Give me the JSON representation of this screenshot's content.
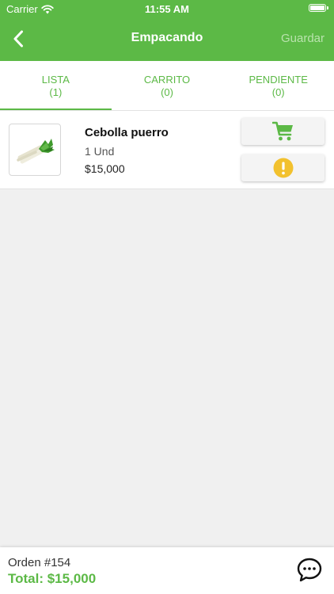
{
  "status_bar": {
    "carrier": "Carrier",
    "time": "11:55 AM",
    "battery_level": 1.0
  },
  "nav": {
    "back_icon": "chevron-left-icon",
    "title": "Empacando",
    "save_label": "Guardar"
  },
  "tabs": [
    {
      "label": "LISTA",
      "count": "(1)",
      "active": true
    },
    {
      "label": "CARRITO",
      "count": "(0)",
      "active": false
    },
    {
      "label": "PENDIENTE",
      "count": "(0)",
      "active": false
    }
  ],
  "items": [
    {
      "name": "Cebolla puerro",
      "quantity": "1 Und",
      "price": "$15,000",
      "image_icon": "leek-icon",
      "cart_icon": "shopping-cart-icon",
      "pending_icon": "exclamation-circle-icon"
    }
  ],
  "footer": {
    "order": "Orden #154",
    "total": "Total: $15,000",
    "chat_icon": "chat-bubble-icon"
  },
  "colors": {
    "brand_green": "#5cb946",
    "warning_yellow": "#f2c12e",
    "background": "#f0f0f0"
  }
}
